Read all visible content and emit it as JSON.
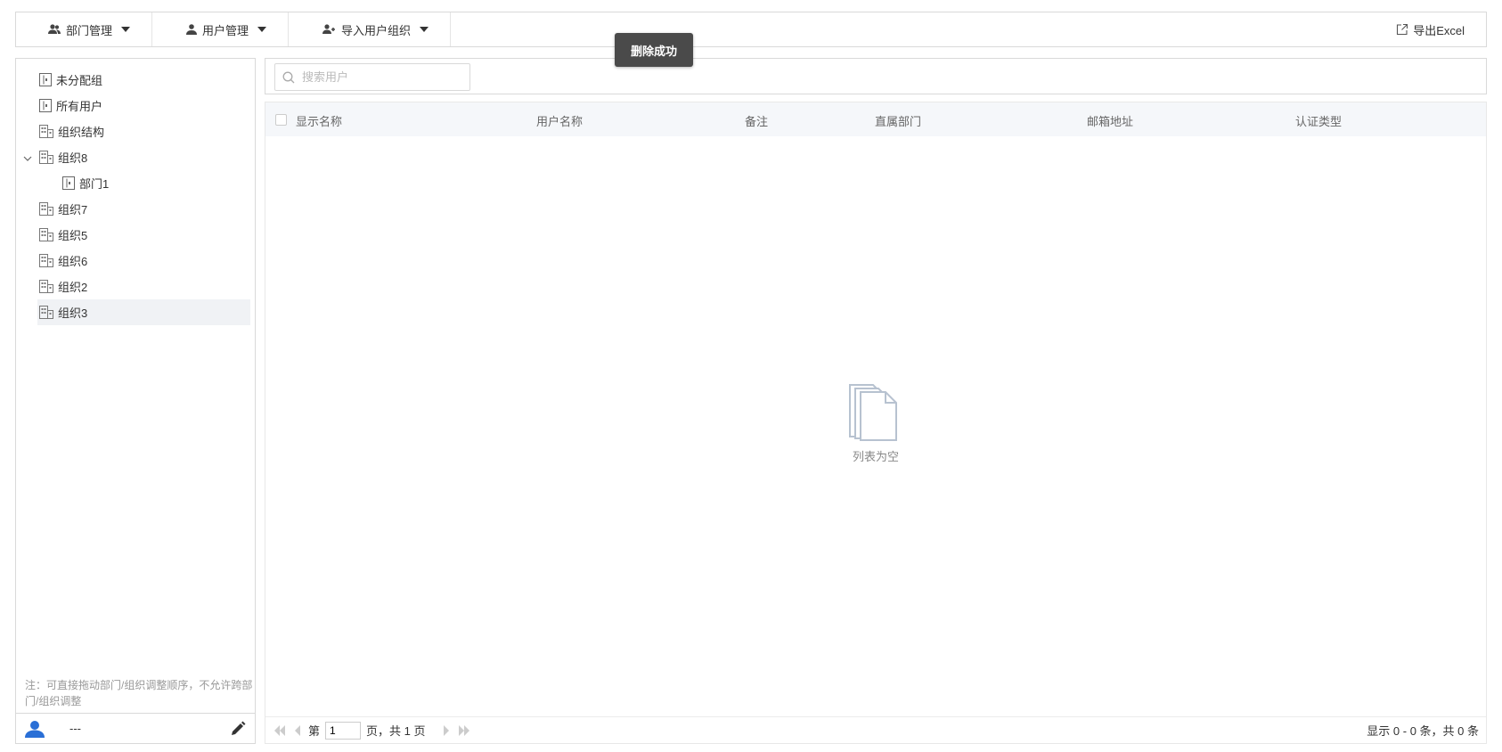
{
  "toolbar": {
    "dept_mgmt": "部门管理",
    "user_mgmt": "用户管理",
    "import": "导入用户组织",
    "export": "导出Excel"
  },
  "toast": "删除成功",
  "tree": [
    {
      "label": "未分配组",
      "icon": "dept-icon"
    },
    {
      "label": "所有用户",
      "icon": "dept-icon"
    },
    {
      "label": "组织结构",
      "icon": "org-icon"
    },
    {
      "label": "组织8",
      "icon": "org-icon",
      "expanded": true
    },
    {
      "label": "部门1",
      "icon": "dept-icon",
      "level": 2
    },
    {
      "label": "组织7",
      "icon": "org-icon"
    },
    {
      "label": "组织5",
      "icon": "org-icon"
    },
    {
      "label": "组织6",
      "icon": "org-icon"
    },
    {
      "label": "组织2",
      "icon": "org-icon"
    },
    {
      "label": "组织3",
      "icon": "org-icon",
      "selected": true
    }
  ],
  "sidebar": {
    "note": "注：可直接拖动部门/组织调整顺序，不允许跨部门/组织调整",
    "user": "---"
  },
  "search": {
    "placeholder": "搜索用户"
  },
  "columns": [
    "显示名称",
    "用户名称",
    "备注",
    "直属部门",
    "邮箱地址",
    "认证类型"
  ],
  "empty_text": "列表为空",
  "pager": {
    "prefix": "第",
    "page": "1",
    "suffix": "页，共 1 页",
    "summary": "显示 0 - 0 条，共 0 条"
  },
  "colors": {
    "accent": "#2a6fd6",
    "toast_bg": "#4a4a4a",
    "border": "#d9d9d9"
  }
}
